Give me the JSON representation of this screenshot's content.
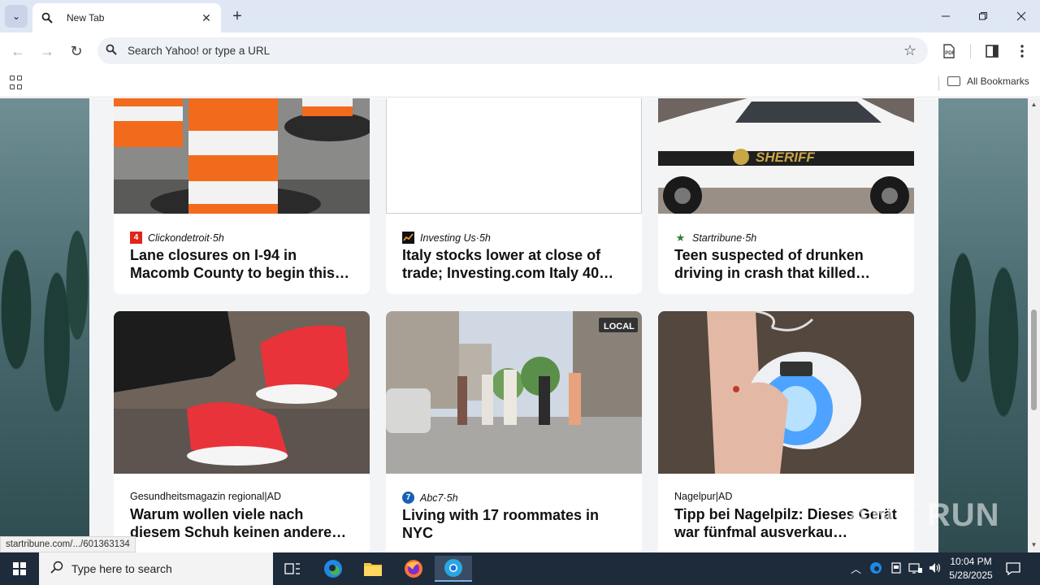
{
  "browser": {
    "tab_title": "New Tab",
    "omnibox_placeholder": "Search Yahoo! or type a URL",
    "all_bookmarks": "All Bookmarks"
  },
  "feed": {
    "cards": [
      {
        "source": "Clickondetroit",
        "age": "5h",
        "sep": " · ",
        "headline": "Lane closures on I-94 in Macomb County to begin this…",
        "logo_color": "#e1251b",
        "logo_text": "4"
      },
      {
        "source": "Investing Us",
        "age": "5h",
        "sep": " · ",
        "headline": "Italy stocks lower at close of trade; Investing.com Italy 40…",
        "logo_color": "#111111",
        "logo_text": ""
      },
      {
        "source": "Startribune",
        "age": "5h",
        "sep": " · ",
        "headline": "Teen suspected of drunken driving in crash that killed…",
        "logo_color": "#2e7d32",
        "logo_text": "★"
      },
      {
        "source": "Gesundheitsmagazin regional",
        "age": "",
        "sep": "|AD",
        "headline": "Warum wollen viele nach diesem Schuh keinen andere…",
        "logo_color": "",
        "logo_text": ""
      },
      {
        "source": "Abc7",
        "age": "5h",
        "sep": " · ",
        "headline": "Living with 17 roommates in NYC",
        "logo_color": "#1a5fb4",
        "logo_text": "7"
      },
      {
        "source": "Nagelpur",
        "age": "",
        "sep": "|AD",
        "headline": "Tipp bei Nagelpilz: Dieses Gerät war fünfmal ausverkau…",
        "logo_color": "",
        "logo_text": ""
      }
    ]
  },
  "status_url": "startribune.com/.../601363134",
  "watermark": "ANY RUN",
  "taskbar": {
    "search_placeholder": "Type here to search",
    "time": "10:04 PM",
    "date": "5/28/2025"
  }
}
